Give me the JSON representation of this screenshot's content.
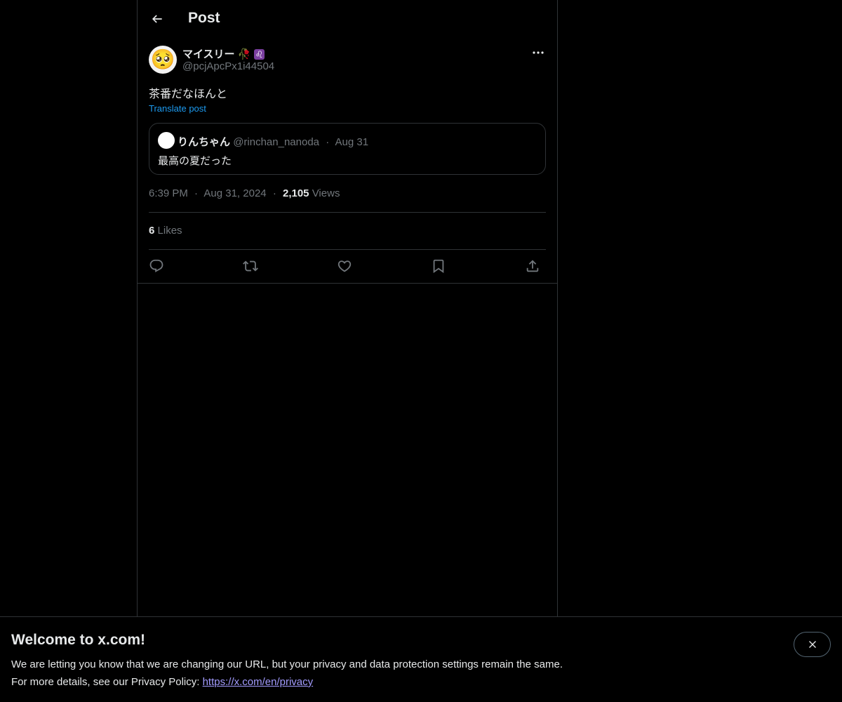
{
  "header": {
    "title": "Post"
  },
  "post": {
    "author": {
      "name": "マイスリー",
      "badges": [
        "🥀",
        "♌"
      ],
      "handle": "@pcjApcPx1i44504",
      "avatar_emoji": "🥺"
    },
    "text": "茶番だなほんと",
    "translate_label": "Translate post",
    "quote": {
      "name": "りんちゃん",
      "handle": "@rinchan_nanoda",
      "dot": "·",
      "date": "Aug 31",
      "text": "最高の夏だった"
    },
    "time": "6:39 PM",
    "date": "Aug 31, 2024",
    "views_count": "2,105",
    "views_label": "Views",
    "likes_count": "6",
    "likes_label": "Likes",
    "dot": "·"
  },
  "actions": [
    "reply-icon",
    "repost-icon",
    "like-icon",
    "bookmark-icon",
    "share-icon"
  ],
  "banner": {
    "title": "Welcome to x.com!",
    "line1": "We are letting you know that we are changing our URL, but your privacy and data protection settings remain the same.",
    "line2_prefix": "For more details, see our Privacy Policy: ",
    "link": "https://x.com/en/privacy"
  },
  "colors": {
    "background": "#000000",
    "text": "#e7e9ea",
    "muted": "#71767b",
    "accent": "#1d9bf0",
    "border": "#2f3336",
    "link": "#a29bfe"
  }
}
